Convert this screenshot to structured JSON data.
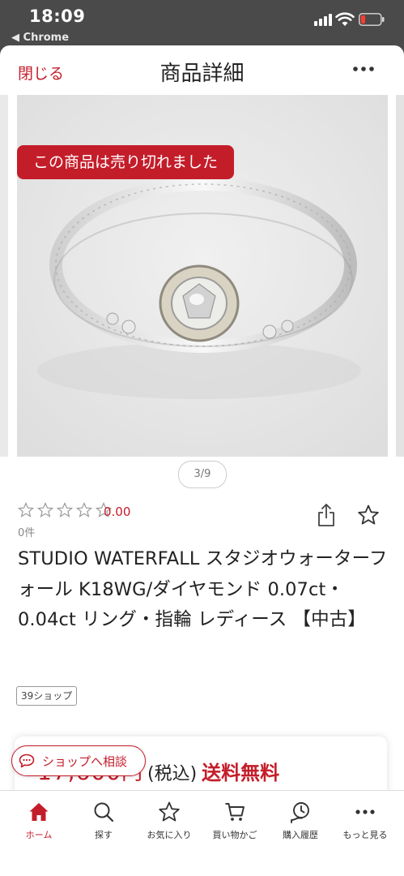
{
  "status_bar": {
    "time": "18:09",
    "back_app": "◀ Chrome"
  },
  "header": {
    "close_label": "閉じる",
    "title": "商品詳細"
  },
  "gallery": {
    "sold_out_label": "この商品は売り切れました",
    "pager": "3/9"
  },
  "product": {
    "rating_value": "0.00",
    "review_count": "0件",
    "title": "STUDIO WATERFALL スタジオウォーターフォール K18WG/ダイヤモンド 0.07ct・0.04ct リング・指輪 レディース 【中古】",
    "shop_tag": "39ショップ"
  },
  "price": {
    "amount": "17,600",
    "yen": "円",
    "tax": "(税込)",
    "shipping": "送料無料"
  },
  "consult_button": {
    "label": "ショップへ相談"
  },
  "tabbar": {
    "items": [
      {
        "label": "ホーム",
        "icon": "home-icon",
        "active": true
      },
      {
        "label": "探す",
        "icon": "search-icon",
        "active": false
      },
      {
        "label": "お気に入り",
        "icon": "star-icon",
        "active": false
      },
      {
        "label": "買い物かご",
        "icon": "cart-icon",
        "active": false
      },
      {
        "label": "購入履歴",
        "icon": "history-icon",
        "active": false
      },
      {
        "label": "もっと見る",
        "icon": "more-icon",
        "active": false
      }
    ]
  },
  "colors": {
    "accent": "#c41d2a",
    "status_bar_bg": "#4a4a4a"
  }
}
